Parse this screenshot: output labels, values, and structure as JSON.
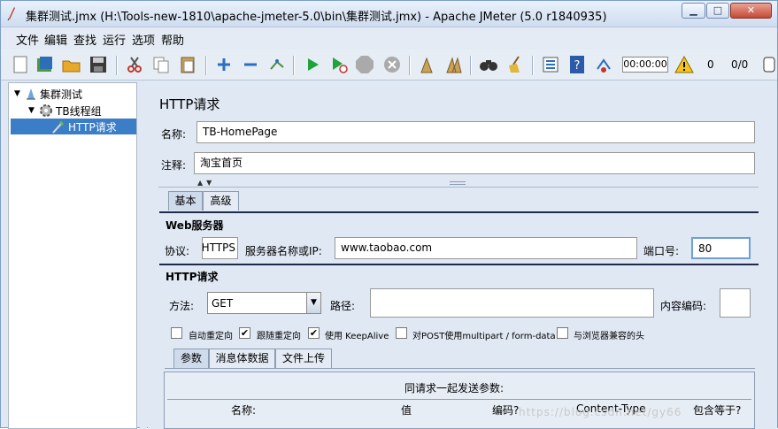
{
  "window": {
    "title": "集群测试.jmx (H:\\Tools-new-1810\\apache-jmeter-5.0\\bin\\集群测试.jmx) - Apache JMeter (5.0 r1840935)"
  },
  "menu": [
    "文件",
    "编辑",
    "查找",
    "运行",
    "选项",
    "帮助"
  ],
  "toolbar": {
    "timer": "00:00:00",
    "warnings": "0",
    "threads": "0/0"
  },
  "tree": {
    "items": [
      {
        "label": "集群测试",
        "icon": "test-plan-icon"
      },
      {
        "label": "TB线程组",
        "icon": "gear-icon"
      },
      {
        "label": "HTTP请求",
        "icon": "pipette-icon"
      }
    ]
  },
  "panel": {
    "title": "HTTP请求",
    "name_label": "名称:",
    "name_value": "TB-HomePage",
    "comment_label": "注释:",
    "comment_value": "淘宝首页",
    "tabs": [
      "基本",
      "高级"
    ],
    "web_server": {
      "title": "Web服务器",
      "protocol_label": "协议:",
      "protocol_value": "HTTPS",
      "server_label": "服务器名称或IP:",
      "server_value": "www.taobao.com",
      "port_label": "端口号:",
      "port_value": "80"
    },
    "http_request": {
      "title": "HTTP请求",
      "method_label": "方法:",
      "method_value": "GET",
      "path_label": "路径:",
      "path_value": "",
      "encoding_label": "内容编码:",
      "encoding_value": ""
    },
    "options": [
      {
        "label": "自动重定向",
        "checked": false
      },
      {
        "label": "跟随重定向",
        "checked": true
      },
      {
        "label": "使用 KeepAlive",
        "checked": true
      },
      {
        "label": "对POST使用multipart / form-data",
        "checked": false
      },
      {
        "label": "与浏览器兼容的头",
        "checked": false
      }
    ],
    "sub_tabs": [
      "参数",
      "消息体数据",
      "文件上传"
    ],
    "params_caption": "同请求一起发送参数:",
    "columns": [
      "名称:",
      "值",
      "编码?",
      "Content-Type",
      "包含等于?"
    ]
  },
  "watermark": "https://blog.csdn.net/gy66"
}
